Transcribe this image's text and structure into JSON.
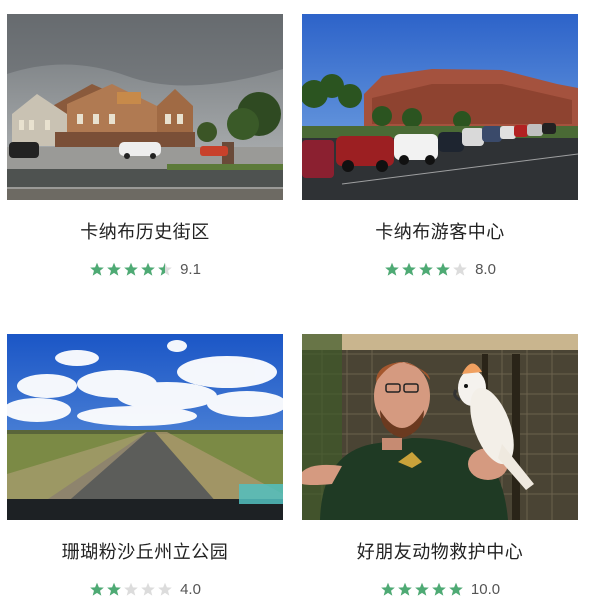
{
  "colors": {
    "star_filled": "#4eaa74",
    "star_empty": "#dcdcdc",
    "text": "#222222",
    "score": "#555555"
  },
  "cards": [
    {
      "name": "卡纳布历史街区",
      "score": "9.1",
      "stars": 4.5,
      "image_icon": "historic-district-photo"
    },
    {
      "name": "卡纳布游客中心",
      "score": "8.0",
      "stars": 4,
      "image_icon": "visitor-center-photo"
    },
    {
      "name": "珊瑚粉沙丘州立公园",
      "score": "4.0",
      "stars": 2,
      "image_icon": "desert-road-photo"
    },
    {
      "name": "好朋友动物救护中心",
      "score": "10.0",
      "stars": 5,
      "image_icon": "parrot-sanctuary-photo"
    }
  ]
}
